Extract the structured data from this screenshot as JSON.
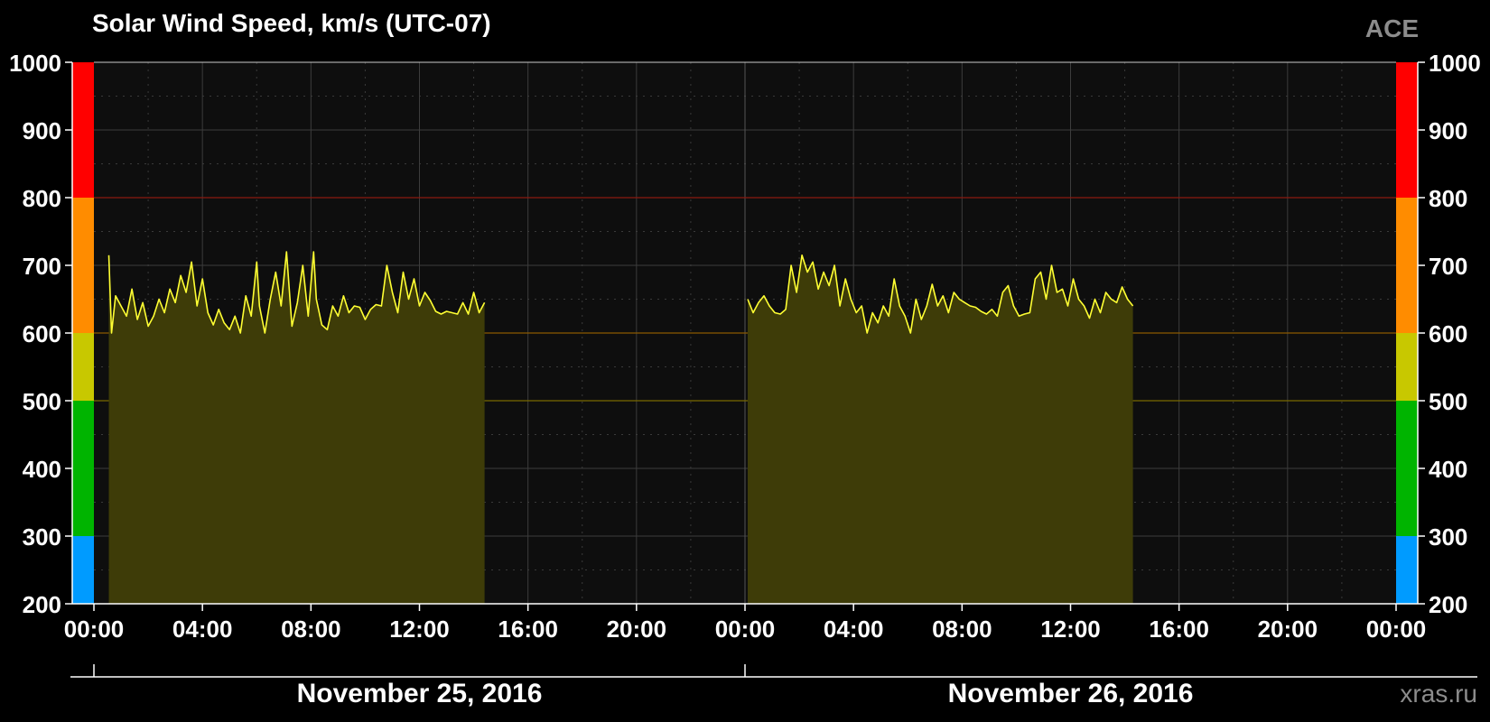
{
  "title": "Solar Wind Speed, km/s (UTC-07)",
  "source": "ACE",
  "watermark": "xras.ru",
  "date_labels": [
    "November 25, 2016",
    "November 26, 2016"
  ],
  "colors": {
    "background": "#000000",
    "plot_background": "#0e0e0e",
    "data_line": "#ffff33",
    "data_fill": "#3e3c08",
    "band_red": "#ff0000",
    "band_orange": "#ff8c00",
    "band_yellow": "#c8c800",
    "band_green": "#00b400",
    "band_blue": "#009bff"
  },
  "chart_data": {
    "type": "area",
    "title": "Solar Wind Speed, km/s (UTC-07)",
    "xlabel": "",
    "ylabel": "",
    "ylim": [
      200,
      1000
    ],
    "yticks": [
      200,
      300,
      400,
      500,
      600,
      700,
      800,
      900,
      1000
    ],
    "xlim_hours": [
      0,
      48
    ],
    "xticks": [
      "00:00",
      "04:00",
      "08:00",
      "12:00",
      "16:00",
      "20:00",
      "00:00",
      "04:00",
      "08:00",
      "12:00",
      "16:00",
      "20:00",
      "00:00"
    ],
    "threshold_bands": [
      {
        "from": 200,
        "to": 300,
        "color": "#009bff"
      },
      {
        "from": 300,
        "to": 500,
        "color": "#00b400"
      },
      {
        "from": 500,
        "to": 600,
        "color": "#c8c800"
      },
      {
        "from": 600,
        "to": 800,
        "color": "#ff8c00"
      },
      {
        "from": 800,
        "to": 1000,
        "color": "#ff0000"
      }
    ],
    "threshold_lines": [
      500,
      600,
      800
    ],
    "grid": true,
    "series": [
      {
        "segments": [
          {
            "x": [
              0.55,
              0.65,
              0.8,
              1.0,
              1.2,
              1.4,
              1.6,
              1.8,
              2.0,
              2.2,
              2.4,
              2.6,
              2.8,
              3.0,
              3.2,
              3.4,
              3.6,
              3.8,
              4.0,
              4.2,
              4.4,
              4.6,
              4.8,
              5.0,
              5.2,
              5.4,
              5.6,
              5.8,
              6.0,
              6.1,
              6.3,
              6.5,
              6.7,
              6.9,
              7.1,
              7.3,
              7.5,
              7.7,
              7.9,
              8.1,
              8.2,
              8.4,
              8.6,
              8.8,
              9.0,
              9.2,
              9.4,
              9.6,
              9.8,
              10.0,
              10.2,
              10.4,
              10.6,
              10.8,
              11.0,
              11.2,
              11.4,
              11.6,
              11.8,
              12.0,
              12.2,
              12.4,
              12.6,
              12.8,
              13.0,
              13.2,
              13.4,
              13.6,
              13.8,
              14.0,
              14.2,
              14.4
            ],
            "y": [
              715,
              600,
              655,
              640,
              625,
              665,
              620,
              645,
              610,
              625,
              650,
              630,
              665,
              645,
              685,
              660,
              705,
              640,
              680,
              630,
              612,
              635,
              615,
              605,
              625,
              600,
              655,
              625,
              705,
              640,
              600,
              650,
              690,
              640,
              720,
              610,
              645,
              700,
              625,
              720,
              650,
              612,
              605,
              640,
              625,
              655,
              630,
              640,
              638,
              620,
              635,
              642,
              640,
              700,
              660,
              630,
              690,
              650,
              680,
              640,
              660,
              648,
              632,
              628,
              632,
              630,
              628,
              645,
              628,
              660,
              630,
              645
            ]
          },
          {
            "x": [
              24.1,
              24.3,
              24.5,
              24.7,
              24.9,
              25.1,
              25.3,
              25.5,
              25.7,
              25.9,
              26.1,
              26.3,
              26.5,
              26.7,
              26.9,
              27.1,
              27.3,
              27.5,
              27.7,
              27.9,
              28.1,
              28.3,
              28.5,
              28.7,
              28.9,
              29.1,
              29.3,
              29.5,
              29.7,
              29.9,
              30.1,
              30.3,
              30.5,
              30.7,
              30.9,
              31.1,
              31.3,
              31.5,
              31.7,
              31.9,
              32.1,
              32.3,
              32.5,
              32.7,
              32.9,
              33.1,
              33.3,
              33.5,
              33.7,
              33.9,
              34.1,
              34.3,
              34.5,
              34.7,
              34.9,
              35.1,
              35.3,
              35.5,
              35.7,
              35.9,
              36.1,
              36.3,
              36.5,
              36.7,
              36.9,
              37.1,
              37.3,
              37.5,
              37.7,
              37.9,
              38.1,
              38.3
            ],
            "y": [
              650,
              630,
              645,
              655,
              640,
              630,
              628,
              635,
              700,
              660,
              715,
              690,
              705,
              665,
              690,
              670,
              700,
              640,
              680,
              650,
              630,
              640,
              600,
              630,
              615,
              640,
              625,
              680,
              640,
              625,
              600,
              650,
              620,
              640,
              672,
              640,
              655,
              630,
              660,
              650,
              645,
              640,
              638,
              632,
              628,
              635,
              625,
              660,
              670,
              640,
              625,
              628,
              630,
              680,
              690,
              650,
              700,
              660,
              665,
              640,
              680,
              650,
              640,
              622,
              650,
              630,
              660,
              650,
              645,
              668,
              650,
              640
            ]
          }
        ]
      }
    ]
  }
}
